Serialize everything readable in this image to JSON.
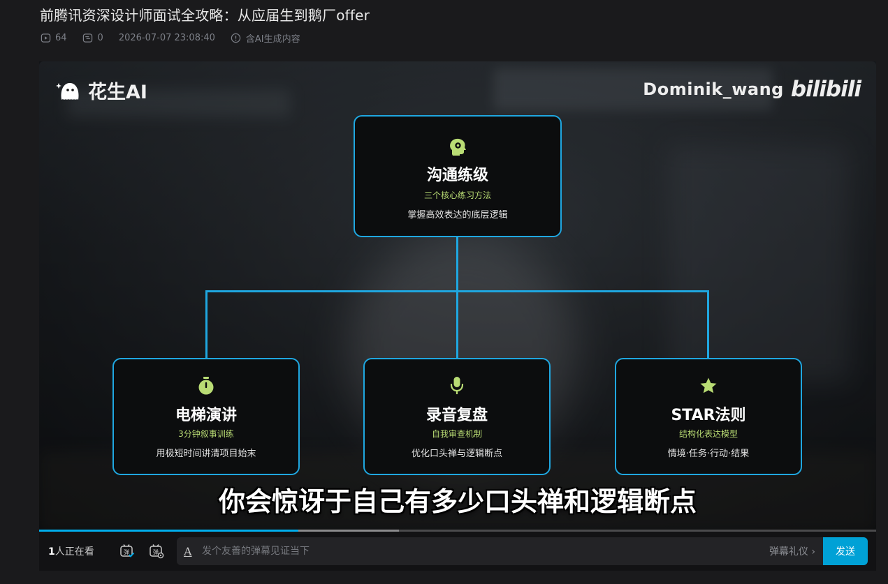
{
  "video": {
    "title": "前腾讯资深设计师面试全攻略：从应届生到鹅厂offer",
    "plays": "64",
    "danmaku_count": "0",
    "datetime": "2026-07-07 23:08:40",
    "ai_notice": "含AI生成内容"
  },
  "player": {
    "brand_left": "花生AI",
    "watermark_user": "Dominik_wang",
    "watermark_logo": "bilibili",
    "subtitle": "你会惊讶于自己有多少口头禅和逻辑断点",
    "progress_played": 0.31,
    "progress_buffered": 0.43,
    "accent_color": "#1fa7e0",
    "sub_color": "#b9dc74"
  },
  "diagram": {
    "root": {
      "icon": "head-gear-icon",
      "title": "沟通练级",
      "subtitle": "三个核心练习方法",
      "desc": "掌握高效表达的底层逻辑"
    },
    "children": [
      {
        "icon": "stopwatch-icon",
        "title": "电梯演讲",
        "subtitle": "3分钟叙事训练",
        "desc": "用极短时间讲清项目始末"
      },
      {
        "icon": "microphone-icon",
        "title": "录音复盘",
        "subtitle": "自我审查机制",
        "desc": "优化口头禅与逻辑断点"
      },
      {
        "icon": "star-icon",
        "title": "STAR法则",
        "subtitle": "结构化表达模型",
        "desc": "情境·任务·行动·结果"
      }
    ]
  },
  "controls": {
    "viewers_count": "1",
    "viewers_text": "人正在看",
    "input_placeholder": "发个友善的弹幕见证当下",
    "etiquette": "弹幕礼仪 ›",
    "send_label": "发送"
  }
}
